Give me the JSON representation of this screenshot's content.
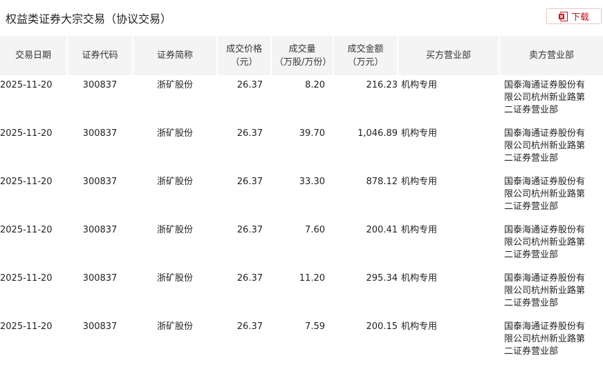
{
  "page": {
    "title": "权益类证券大宗交易（协议交易）",
    "download_label": "下载"
  },
  "colors": {
    "accent": "#c8101a",
    "header_bg": "#f4f4f4"
  },
  "icons": {
    "download": "excel-file-icon"
  },
  "table": {
    "headers": [
      [
        "交易日期"
      ],
      [
        "证券代码"
      ],
      [
        "证券简称"
      ],
      [
        "成交价格",
        "（元）"
      ],
      [
        "成交量",
        "（万股/万份）"
      ],
      [
        "成交金额",
        "（万元）"
      ],
      [
        "买方营业部"
      ],
      [
        "卖方营业部"
      ]
    ],
    "rows": [
      {
        "date": "2025-11-20",
        "code": "300837",
        "name": "浙矿股份",
        "price": "26.37",
        "volume": "8.20",
        "amount": "216.23",
        "buyer": "机构专用",
        "seller": "国泰海通证券股份有限公司杭州新业路第二证券营业部"
      },
      {
        "date": "2025-11-20",
        "code": "300837",
        "name": "浙矿股份",
        "price": "26.37",
        "volume": "39.70",
        "amount": "1,046.89",
        "buyer": "机构专用",
        "seller": "国泰海通证券股份有限公司杭州新业路第二证券营业部"
      },
      {
        "date": "2025-11-20",
        "code": "300837",
        "name": "浙矿股份",
        "price": "26.37",
        "volume": "33.30",
        "amount": "878.12",
        "buyer": "机构专用",
        "seller": "国泰海通证券股份有限公司杭州新业路第二证券营业部"
      },
      {
        "date": "2025-11-20",
        "code": "300837",
        "name": "浙矿股份",
        "price": "26.37",
        "volume": "7.60",
        "amount": "200.41",
        "buyer": "机构专用",
        "seller": "国泰海通证券股份有限公司杭州新业路第二证券营业部"
      },
      {
        "date": "2025-11-20",
        "code": "300837",
        "name": "浙矿股份",
        "price": "26.37",
        "volume": "11.20",
        "amount": "295.34",
        "buyer": "机构专用",
        "seller": "国泰海通证券股份有限公司杭州新业路第二证券营业部"
      },
      {
        "date": "2025-11-20",
        "code": "300837",
        "name": "浙矿股份",
        "price": "26.37",
        "volume": "7.59",
        "amount": "200.15",
        "buyer": "机构专用",
        "seller": "国泰海通证券股份有限公司杭州新业路第二证券营业部"
      }
    ]
  }
}
